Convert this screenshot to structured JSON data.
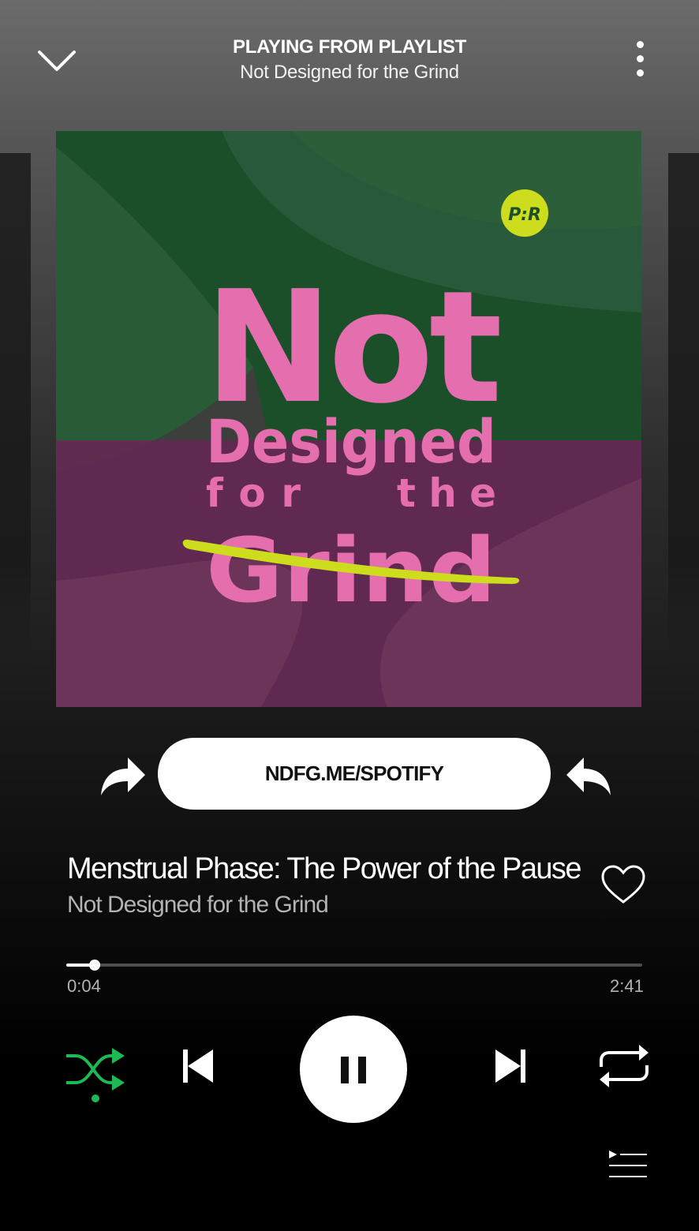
{
  "header": {
    "context_label": "PLAYING FROM PLAYLIST",
    "playlist_name": "Not Designed for the Grind"
  },
  "cover": {
    "badge_text": "P:R",
    "title_line1": "Not",
    "title_line2": "Designed",
    "title_for": "for",
    "title_the": "the",
    "title_line4": "Grind",
    "colors": {
      "green_top": "#2a5c37",
      "green_dark": "#1b4f2a",
      "purple": "#6b3458",
      "purple_dark": "#5a2550",
      "pink": "#e56eaf",
      "lime": "#cddc1c"
    }
  },
  "share": {
    "link_label": "NDFG.ME/SPOTIFY"
  },
  "track": {
    "title": "Menstrual Phase: The Power of the Pause",
    "artist": "Not Designed for the Grind",
    "liked": false
  },
  "playback": {
    "elapsed": "0:04",
    "duration": "2:41",
    "progress_fraction": 0.049,
    "state": "playing",
    "shuffle_enabled": true,
    "repeat_enabled": false
  },
  "icons": {
    "collapse": "chevron-down-icon",
    "more": "more-vertical-icon",
    "share_left": "share-arrow-icon",
    "share_right": "reply-arrow-icon",
    "like": "heart-icon",
    "shuffle": "shuffle-icon",
    "previous": "skip-previous-icon",
    "pause": "pause-icon",
    "next": "skip-next-icon",
    "repeat": "repeat-icon",
    "queue": "queue-icon"
  },
  "colors": {
    "accent": "#1db954",
    "text_secondary": "#b3b3b3"
  }
}
